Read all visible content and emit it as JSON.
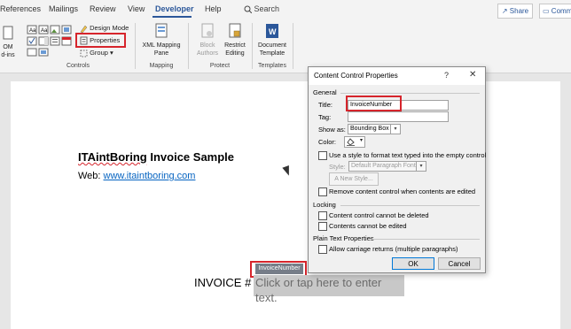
{
  "ribbon": {
    "tabs": [
      "References",
      "Mailings",
      "Review",
      "View",
      "Developer",
      "Help"
    ],
    "active_tab": "Developer",
    "search": "Search",
    "share": "Share",
    "comments": "Comm",
    "controls": {
      "design_mode": "Design Mode",
      "properties": "Properties",
      "group": "Group",
      "label": "Controls",
      "com_addins_1": "OM",
      "com_addins_2": "d-ins"
    },
    "mapping": {
      "xml_1": "XML Mapping",
      "xml_2": "Pane",
      "label": "Mapping"
    },
    "protect": {
      "block_1": "Block",
      "block_2": "Authors",
      "restrict_1": "Restrict",
      "restrict_2": "Editing",
      "label": "Protect"
    },
    "templates": {
      "doc_1": "Document",
      "doc_2": "Template",
      "label": "Templates"
    }
  },
  "document": {
    "title_squiggle": "ITAintBoring",
    "title_rest": " Invoice Sample",
    "web_label": "Web: ",
    "web_link": "www.itaintboring.com",
    "invoice_label": "INVOICE # ",
    "control_placeholder": "Click or tap here to enter text.",
    "control_tag": "InvoiceNumber"
  },
  "dialog": {
    "title": "Content Control Properties",
    "help": "?",
    "close": "✕",
    "general": "General",
    "title_label": "Title:",
    "title_value": "InvoiceNumber",
    "tag_label": "Tag:",
    "tag_value": "",
    "show_as_label": "Show as:",
    "show_as_value": "Bounding Box",
    "color_label": "Color:",
    "use_style": "Use a style to format text typed into the empty control",
    "style_label": "Style:",
    "style_value": "Default Paragraph Font",
    "new_style": "New Style...",
    "remove_control": "Remove content control when contents are edited",
    "locking": "Locking",
    "cannot_delete": "Content control cannot be deleted",
    "cannot_edit": "Contents cannot be edited",
    "plain_text": "Plain Text Properties",
    "allow_returns": "Allow carriage returns (multiple paragraphs)",
    "ok": "OK",
    "cancel": "Cancel"
  },
  "colors": {
    "accent": "#2b579a",
    "highlight": "#d6252c",
    "link": "#0563c1"
  }
}
